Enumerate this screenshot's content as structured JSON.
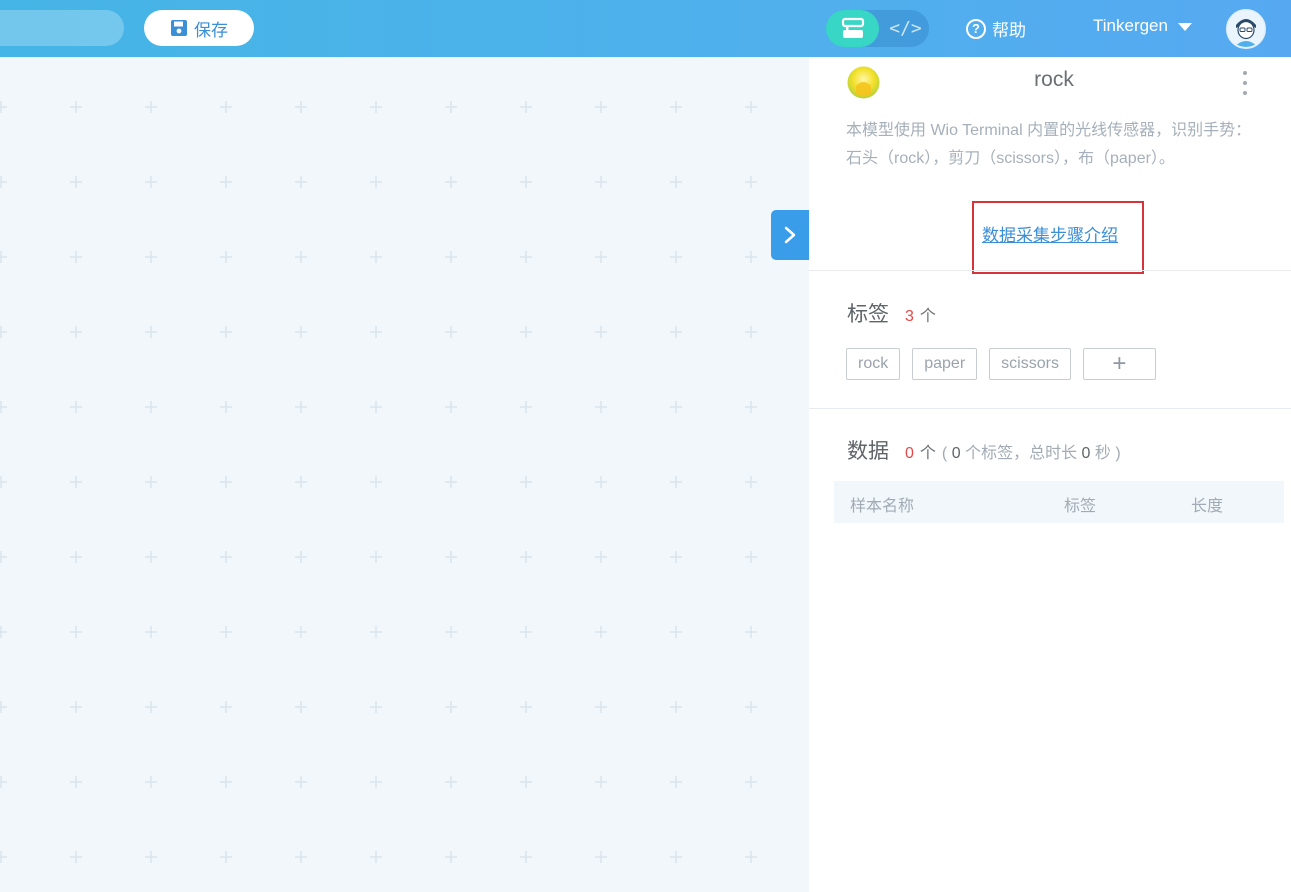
{
  "header": {
    "save_label": "保存",
    "mode_code_label": "</>",
    "help_label": "帮助",
    "username": "Tinkergen"
  },
  "model": {
    "title": "rock",
    "description": "本模型使用 Wio Terminal 内置的光线传感器，识别手势：石头（rock），剪刀（scissors），布（paper）。",
    "guide_link": "数据采集步骤介绍"
  },
  "labels_section": {
    "title": "标签",
    "count": "3",
    "unit": "个",
    "tags": [
      "rock",
      "paper",
      "scissors"
    ],
    "add_label": "+"
  },
  "data_section": {
    "title": "数据",
    "count": "0",
    "unit": "个",
    "detail_open": "(",
    "label_count": "0",
    "label_unit": "个标签，总时长",
    "duration": "0",
    "duration_unit": "秒",
    "detail_close": ")"
  },
  "samples_table": {
    "columns": [
      "样本名称",
      "标签",
      "长度"
    ]
  },
  "colors": {
    "accent": "#3b8fd6",
    "count_red": "#e54848",
    "highlight": "#d6333a",
    "mode_active": "#38d6c4"
  }
}
